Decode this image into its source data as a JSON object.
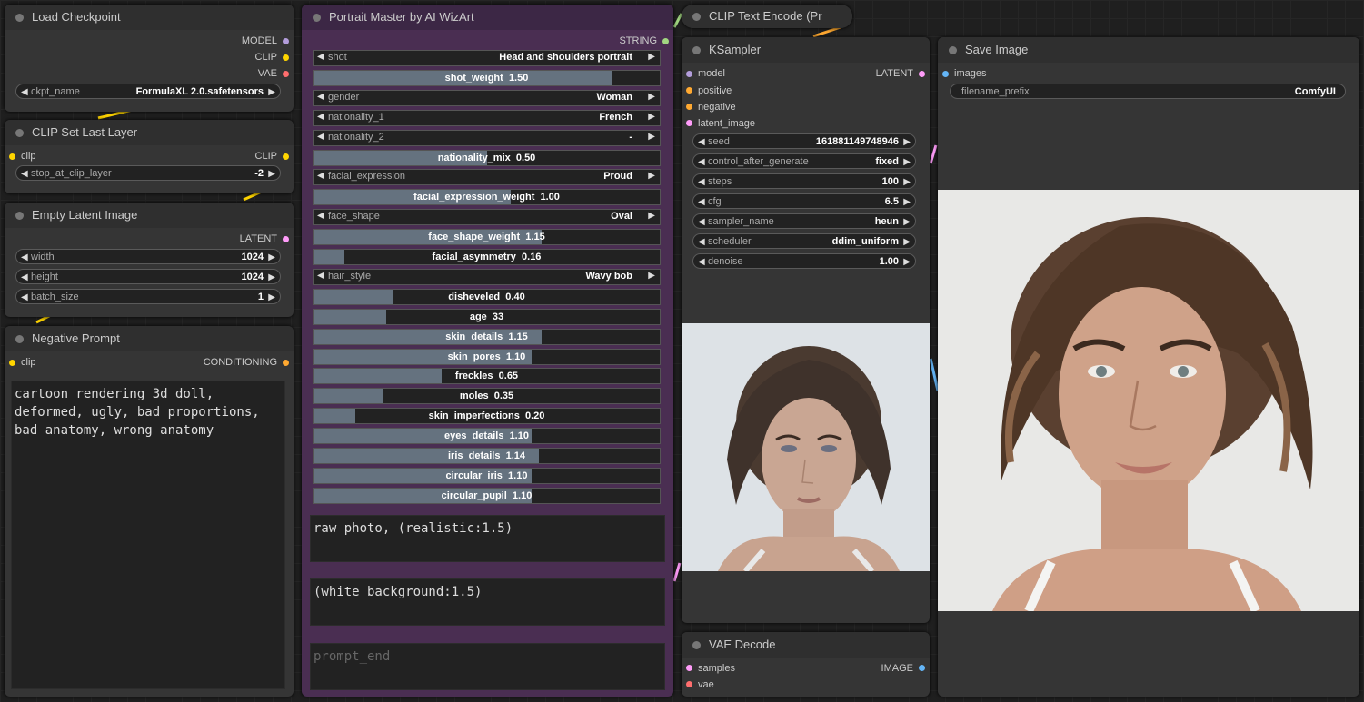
{
  "colors": {
    "model": "#b39ddb",
    "clip": "#ffd500",
    "vae": "#ff6e6e",
    "latent": "#ff9cf9",
    "conditioning": "#ffa931",
    "string": "#a1d681",
    "image": "#64b5f6"
  },
  "load_checkpoint": {
    "title": "Load Checkpoint",
    "out_model": "MODEL",
    "out_clip": "CLIP",
    "out_vae": "VAE",
    "ckpt_name_label": "ckpt_name",
    "ckpt_name_value": "FormulaXL 2.0.safetensors"
  },
  "clip_set_last_layer": {
    "title": "CLIP Set Last Layer",
    "in_clip": "clip",
    "out_clip": "CLIP",
    "stop_label": "stop_at_clip_layer",
    "stop_value": "-2"
  },
  "empty_latent": {
    "title": "Empty Latent Image",
    "out_latent": "LATENT",
    "width_label": "width",
    "width_value": "1024",
    "height_label": "height",
    "height_value": "1024",
    "batch_label": "batch_size",
    "batch_value": "1"
  },
  "negative_prompt": {
    "title": "Negative Prompt",
    "in_clip": "clip",
    "out_conditioning": "CONDITIONING",
    "text": "cartoon rendering 3d doll, deformed, ugly, bad proportions, bad anatomy, wrong anatomy"
  },
  "portrait_master": {
    "title": "Portrait Master by AI WizArt",
    "out_string": "STRING",
    "widgets": [
      {
        "kind": "combo",
        "name": "shot",
        "value": "Head and shoulders portrait"
      },
      {
        "kind": "slider",
        "name": "shot_weight",
        "value": "1.50",
        "fill": 0.86
      },
      {
        "kind": "combo",
        "name": "gender",
        "value": "Woman"
      },
      {
        "kind": "combo",
        "name": "nationality_1",
        "value": "French"
      },
      {
        "kind": "combo",
        "name": "nationality_2",
        "value": "-"
      },
      {
        "kind": "slider",
        "name": "nationality_mix",
        "value": "0.50",
        "fill": 0.5
      },
      {
        "kind": "combo",
        "name": "facial_expression",
        "value": "Proud"
      },
      {
        "kind": "slider",
        "name": "facial_expression_weight",
        "value": "1.00",
        "fill": 0.57
      },
      {
        "kind": "combo",
        "name": "face_shape",
        "value": "Oval"
      },
      {
        "kind": "slider",
        "name": "face_shape_weight",
        "value": "1.15",
        "fill": 0.66
      },
      {
        "kind": "slider",
        "name": "facial_asymmetry",
        "value": "0.16",
        "fill": 0.09
      },
      {
        "kind": "combo",
        "name": "hair_style",
        "value": "Wavy bob"
      },
      {
        "kind": "slider",
        "name": "disheveled",
        "value": "0.40",
        "fill": 0.23
      },
      {
        "kind": "slider",
        "name": "age",
        "value": "33",
        "fill": 0.21
      },
      {
        "kind": "slider",
        "name": "skin_details",
        "value": "1.15",
        "fill": 0.66
      },
      {
        "kind": "slider",
        "name": "skin_pores",
        "value": "1.10",
        "fill": 0.63
      },
      {
        "kind": "slider",
        "name": "freckles",
        "value": "0.65",
        "fill": 0.37
      },
      {
        "kind": "slider",
        "name": "moles",
        "value": "0.35",
        "fill": 0.2
      },
      {
        "kind": "slider",
        "name": "skin_imperfections",
        "value": "0.20",
        "fill": 0.12
      },
      {
        "kind": "slider",
        "name": "eyes_details",
        "value": "1.10",
        "fill": 0.63
      },
      {
        "kind": "slider",
        "name": "iris_details",
        "value": "1.14",
        "fill": 0.65
      },
      {
        "kind": "slider",
        "name": "circular_iris",
        "value": "1.10",
        "fill": 0.63
      },
      {
        "kind": "slider",
        "name": "circular_pupil",
        "value": "1.10",
        "fill": 0.63
      }
    ],
    "prompt_start": "raw photo, (realistic:1.5)",
    "prompt_additional": "(white background:1.5)",
    "prompt_end_placeholder": "prompt_end"
  },
  "clip_text_encode": {
    "title": "CLIP Text Encode (Pr"
  },
  "ksampler": {
    "title": "KSampler",
    "in_model": "model",
    "in_positive": "positive",
    "in_negative": "negative",
    "in_latent": "latent_image",
    "out_latent": "LATENT",
    "widgets": [
      {
        "name": "seed",
        "value": "161881149748946"
      },
      {
        "name": "control_after_generate",
        "value": "fixed"
      },
      {
        "name": "steps",
        "value": "100"
      },
      {
        "name": "cfg",
        "value": "6.5"
      },
      {
        "name": "sampler_name",
        "value": "heun"
      },
      {
        "name": "scheduler",
        "value": "ddim_uniform"
      },
      {
        "name": "denoise",
        "value": "1.00"
      }
    ]
  },
  "save_image": {
    "title": "Save Image",
    "in_images": "images",
    "prefix_label": "filename_prefix",
    "prefix_value": "ComfyUI"
  },
  "vae_decode": {
    "title": "VAE Decode",
    "in_samples": "samples",
    "in_vae": "vae",
    "out_image": "IMAGE"
  }
}
